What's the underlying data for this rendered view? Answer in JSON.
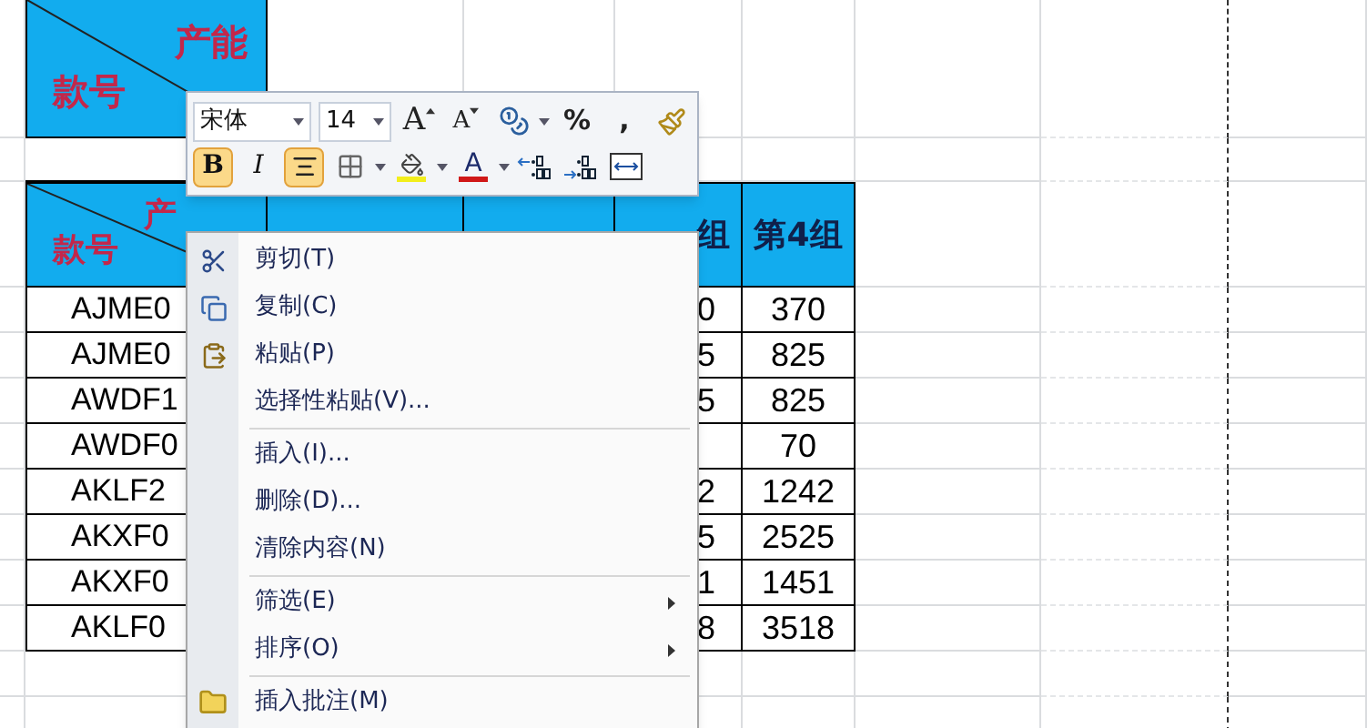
{
  "top_block": {
    "upper": "产能",
    "lower": "款号"
  },
  "table": {
    "corner": {
      "upper": "产",
      "lower": "款号"
    },
    "columns": {
      "column_3": "组",
      "column_4": "第4组"
    },
    "rows": [
      {
        "code": "AJME0",
        "column_3": "0",
        "column_4": "370"
      },
      {
        "code": "AJME0",
        "column_3": "5",
        "column_4": "825"
      },
      {
        "code": "AWDF1",
        "column_3": "5",
        "column_4": "825"
      },
      {
        "code": "AWDF0",
        "column_4": "70"
      },
      {
        "code": "AKLF2",
        "column_3": "2",
        "column_4": "1242"
      },
      {
        "code": "AKXF0",
        "column_3": "5",
        "column_4": "2525"
      },
      {
        "code": "AKXF0",
        "column_3": "1",
        "column_4": "1451"
      },
      {
        "code": "AKLF0",
        "column_3": "8",
        "column_4": "3518"
      }
    ]
  },
  "mini_toolbar": {
    "font": "宋体",
    "size": "14",
    "top_buttons": [
      {
        "kind": "grow",
        "label": "A"
      },
      {
        "kind": "shrink",
        "label": "A"
      },
      {
        "kind": "accounting",
        "dropdown": true
      },
      {
        "kind": "text",
        "label": "%"
      },
      {
        "kind": "text",
        "label": ","
      },
      {
        "kind": "painter"
      }
    ],
    "format_buttons": [
      {
        "kind": "bold",
        "label": "B",
        "selected": true
      },
      {
        "kind": "italic",
        "label": "I",
        "selected": false
      },
      {
        "kind": "center",
        "selected": true
      },
      {
        "kind": "borders",
        "dropdown": true
      },
      {
        "kind": "fill",
        "dropdown": true
      },
      {
        "kind": "fontcolor",
        "label": "A",
        "dropdown": true
      },
      {
        "kind": "adddecimal"
      },
      {
        "kind": "removedecimal"
      },
      {
        "kind": "merge"
      }
    ]
  },
  "context_menu": {
    "items": [
      {
        "kind": "cut",
        "label": "剪切(T)"
      },
      {
        "kind": "copy",
        "label": "复制(C)"
      },
      {
        "kind": "paste",
        "label": "粘贴(P)"
      },
      {
        "kind": "plain",
        "label": "选择性粘贴(V)..."
      },
      {
        "kind": "separator"
      },
      {
        "kind": "plain",
        "label": "插入(I)..."
      },
      {
        "kind": "plain",
        "label": "删除(D)..."
      },
      {
        "kind": "plain",
        "label": "清除内容(N)"
      },
      {
        "kind": "separator"
      },
      {
        "kind": "submenu",
        "label": "筛选(E)"
      },
      {
        "kind": "submenu",
        "label": "排序(O)"
      },
      {
        "kind": "separator"
      },
      {
        "kind": "comment",
        "label": "插入批注(M)"
      }
    ]
  }
}
